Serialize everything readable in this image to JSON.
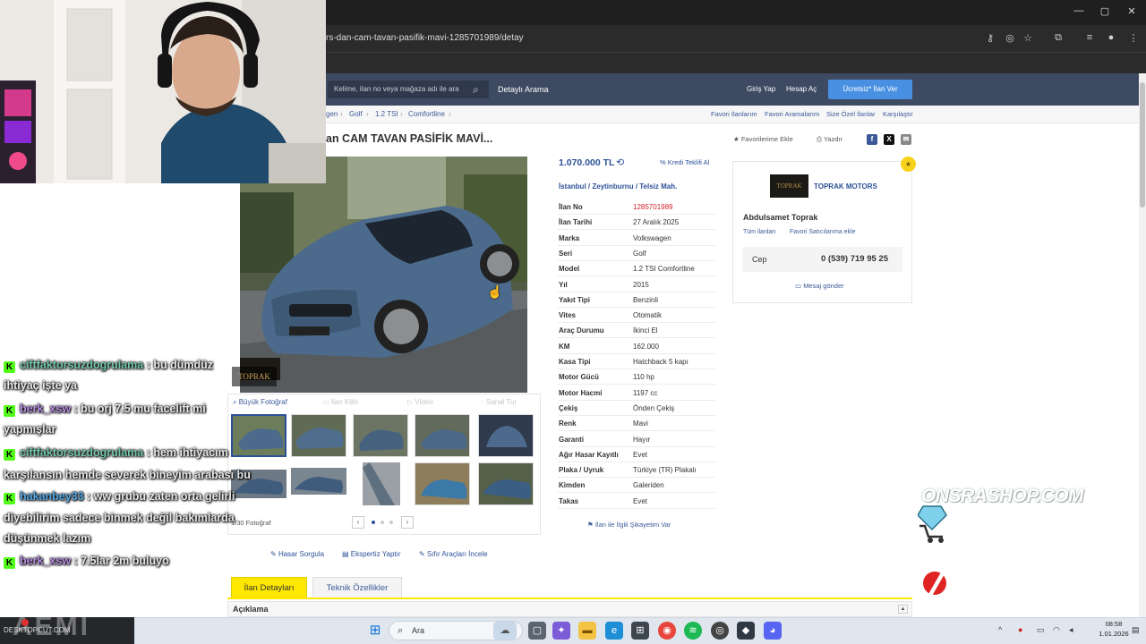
{
  "browser": {
    "url": "rs-dan-cam-tavan-pasifik-mavi-1285701989/detay",
    "window_controls": [
      "—",
      "▢",
      "✕"
    ]
  },
  "header": {
    "search_placeholder": "Kelime, ilan no veya mağaza adı ile ara",
    "advanced_search": "Detaylı Arama",
    "login": "Giriş Yap",
    "signup": "Hesap Aç",
    "post_ad": "Ücretsiz* İlan Ver"
  },
  "breadcrumb": [
    "gen",
    "Golf",
    "1.2 TSI",
    "Comfortline"
  ],
  "top_links": [
    "Favori İlanlarım",
    "Favori Aramalarım",
    "Size Özel İlanlar",
    "Karşılaştır"
  ],
  "listing": {
    "title": "an CAM TAVAN PASİFİK MAVİ...",
    "add_favorite": "Favorilerime Ekle",
    "print": "Yazdır",
    "price": "1.070.000 TL",
    "credit": "Kredi Teklifi Al",
    "location": [
      "İstanbul",
      "Zeytinburnu",
      "Telsiz Mah."
    ],
    "details": [
      {
        "k": "İlan No",
        "v": "1285701989",
        "accent": true
      },
      {
        "k": "İlan Tarihi",
        "v": "27 Aralık 2025"
      },
      {
        "k": "Marka",
        "v": "Volkswagen"
      },
      {
        "k": "Seri",
        "v": "Golf"
      },
      {
        "k": "Model",
        "v": "1.2 TSI Comfortline"
      },
      {
        "k": "Yıl",
        "v": "2015"
      },
      {
        "k": "Yakıt Tipi",
        "v": "Benzinli"
      },
      {
        "k": "Vites",
        "v": "Otomatik"
      },
      {
        "k": "Araç Durumu",
        "v": "İkinci El"
      },
      {
        "k": "KM",
        "v": "162.000"
      },
      {
        "k": "Kasa Tipi",
        "v": "Hatchback 5 kapı"
      },
      {
        "k": "Motor Gücü",
        "v": "110 hp"
      },
      {
        "k": "Motor Hacmi",
        "v": "1197 cc"
      },
      {
        "k": "Çekiş",
        "v": "Önden Çekiş"
      },
      {
        "k": "Renk",
        "v": "Mavi"
      },
      {
        "k": "Garanti",
        "v": "Hayır"
      },
      {
        "k": "Ağır Hasar Kayıtlı",
        "v": "Evet"
      },
      {
        "k": "Plaka / Uyruk",
        "v": "Türkiye (TR) Plakalı"
      },
      {
        "k": "Kimden",
        "v": "Galeriden"
      },
      {
        "k": "Takas",
        "v": "Evet"
      }
    ],
    "complain": "İlan ile İlgili Şikayetim Var"
  },
  "photos": {
    "big_photo": "Büyük Fotoğraf",
    "video_call": "İlan Klibi",
    "video": "Video",
    "virtual_tour": "Sanal Tur",
    "counter": "1/30 Fotoğraf",
    "watermark": "TOPRAK"
  },
  "seller": {
    "logo_text": "TOPRAK",
    "store": "TOPRAK MOTORS",
    "name": "Abdulsamet Toprak",
    "all_ads": "Tüm ilanları",
    "fav_seller": "Favori Satıcılarıma ekle",
    "phone_label": "Cep",
    "phone": "0 (539) 719 95 25",
    "message": "Mesaj gönder"
  },
  "actions": [
    "Hasar Sorgula",
    "Ekspertiz Yaptır",
    "Sıfır Araçları İncele"
  ],
  "tabs": [
    "İlan Detayları",
    "Teknik Özellikler"
  ],
  "description": "Açıklama",
  "chat": [
    {
      "user": "ciftfaktorsuzdogrulama",
      "cls": "u1",
      "msg": " : bu dümdüz",
      "cont": "ihtiyaç işte ya"
    },
    {
      "user": "berk_xsw",
      "cls": "u2",
      "msg": " : bu orj 7.5 mu facelift mi",
      "cont": "yapmışlar"
    },
    {
      "user": "ciftfaktorsuzdogrulama",
      "cls": "u1",
      "msg": " : hem ihtiyacım",
      "cont": "karşılansın hemde severek bineyim arabası bu"
    },
    {
      "user": "hakanbey33",
      "cls": "u3",
      "msg": " : ww grubu zaten orta gelirli",
      "cont": "diyebilirim sadece binmek değil bakımlarda",
      "cont2": "düşünmek lazım"
    },
    {
      "user": "berk_xsw",
      "cls": "u2",
      "msg": " : 7.5lar 2m buluyo"
    }
  ],
  "overlay": {
    "shop": "ONSRASHOP.COM",
    "aemi": "AEMI",
    "watermark": "DESKTOPCUT.COM"
  },
  "taskbar": {
    "search": "Ara",
    "time": "08:58",
    "date": "1.01.2026"
  },
  "colors": {
    "accent": "#2d5198",
    "highlight": "#ffe800",
    "header": "#3e4a61",
    "red": "#d2232a"
  }
}
